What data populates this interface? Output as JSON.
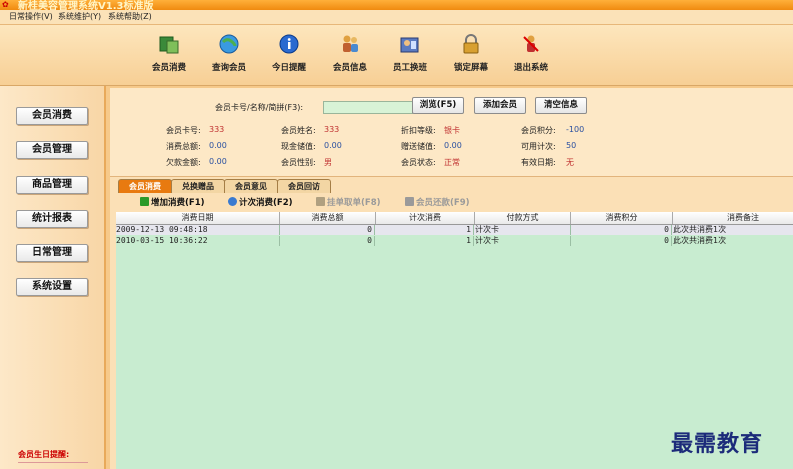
{
  "window": {
    "title": "新桂美容管理系统V1.3标准版"
  },
  "menu": [
    "日常操作(V)",
    "系统维护(Y)",
    "系统帮助(Z)"
  ],
  "toolbar": [
    {
      "label": "会员消费",
      "icon": "member-consume-icon"
    },
    {
      "label": "查询会员",
      "icon": "query-member-icon"
    },
    {
      "label": "今日提醒",
      "icon": "info-icon"
    },
    {
      "label": "会员信息",
      "icon": "member-info-icon"
    },
    {
      "label": "员工换班",
      "icon": "staff-shift-icon"
    },
    {
      "label": "锁定屏幕",
      "icon": "lock-icon"
    },
    {
      "label": "退出系统",
      "icon": "exit-icon"
    }
  ],
  "leftnav": [
    "会员消费",
    "会员管理",
    "商品管理",
    "统计报表",
    "日常管理",
    "系统设置"
  ],
  "birthday_label": "会员生日提醒:",
  "search": {
    "label": "会员卡号/名称/简拼(F3):",
    "value": "",
    "browse": "浏览(F5)",
    "add": "添加会员",
    "clear": "清空信息"
  },
  "member": {
    "card_no_label": "会员卡号:",
    "card_no": "333",
    "name_label": "会员姓名:",
    "name": "333",
    "discount_label": "折扣等级:",
    "discount": "银卡",
    "points_label": "会员积分:",
    "points": "-100",
    "total_label": "消费总额:",
    "total": "0.00",
    "cash_label": "现金储值:",
    "cash": "0.00",
    "gift_label": "赠送储值:",
    "gift": "0.00",
    "count_label": "可用计次:",
    "count": "50",
    "debt_label": "欠款金额:",
    "debt": "0.00",
    "gender_label": "会员性别:",
    "gender": "男",
    "status_label": "会员状态:",
    "status": "正常",
    "expiry_label": "有效日期:",
    "expiry": "无"
  },
  "tabs": [
    "会员消费",
    "兑换赠品",
    "会员意见",
    "会员回访"
  ],
  "actions": [
    {
      "label": "增加消费(F1)",
      "enabled": true,
      "color": "#2a9a2a"
    },
    {
      "label": "计次消费(F2)",
      "enabled": true,
      "color": "#3a7ad0"
    },
    {
      "label": "挂单取单(F8)",
      "enabled": false,
      "color": "#b0a080"
    },
    {
      "label": "会员还款(F9)",
      "enabled": false,
      "color": "#9a9a9a"
    }
  ],
  "table": {
    "headers": [
      "消费日期",
      "消费总额",
      "计次消费",
      "付款方式",
      "消费积分",
      "消费备注"
    ],
    "rows": [
      [
        "2009-12-13 09:48:18",
        "0",
        "1",
        "计次卡",
        "0",
        "此次共消费1次"
      ],
      [
        "2010-03-15 10:36:22",
        "0",
        "1",
        "计次卡",
        "0",
        "此次共消费1次"
      ]
    ]
  },
  "watermark": "最需教育"
}
